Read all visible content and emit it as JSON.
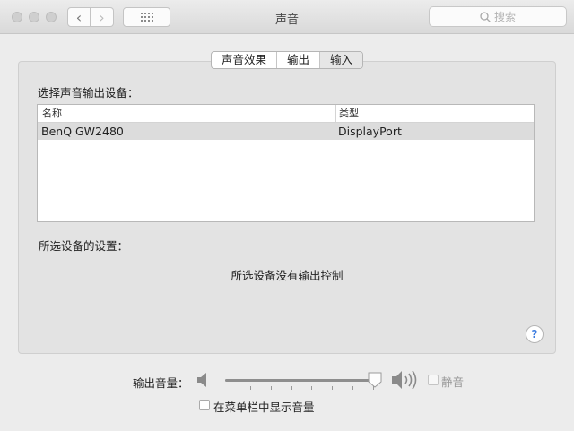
{
  "window": {
    "title": "声音"
  },
  "toolbar": {
    "back_label": "‹",
    "forward_label": "›"
  },
  "search": {
    "placeholder": "搜索"
  },
  "tabs": [
    {
      "label": "声音效果",
      "selected": false
    },
    {
      "label": "输出",
      "selected": false
    },
    {
      "label": "输入",
      "selected": true
    }
  ],
  "output": {
    "select_label": "选择声音输出设备：",
    "columns": [
      "名称",
      "类型"
    ],
    "devices": [
      {
        "name": "BenQ GW2480",
        "type": "DisplayPort",
        "selected": true
      }
    ],
    "settings_label": "所选设备的设置：",
    "no_control_text": "所选设备没有输出控制"
  },
  "help": {
    "label": "?"
  },
  "volume": {
    "label": "输出音量：",
    "level_percent": 100,
    "mute_label": "静音",
    "mute_checked": false,
    "menubar_label": "在菜单栏中显示音量",
    "menubar_checked": false
  },
  "colors": {
    "accent": "#3d7de0",
    "row_highlight": "#dcdcdc"
  }
}
